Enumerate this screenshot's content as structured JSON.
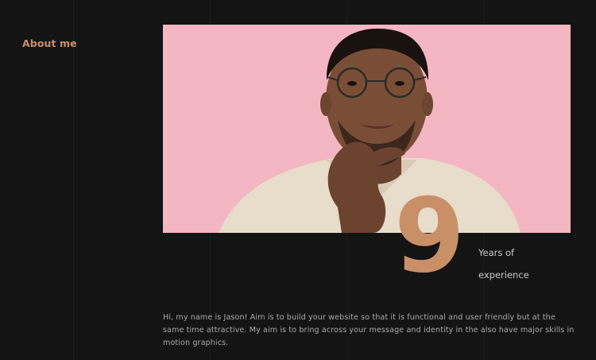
{
  "section": {
    "label": "About me"
  },
  "photo": {
    "subject": "portrait-photo",
    "background_color": "#f4b6c2"
  },
  "experience": {
    "number": "9",
    "line1": "Years of",
    "line2": "experience"
  },
  "bio": {
    "text": "Hi, my name is Jason! Aim is to build your website so that it is functional and user friendly but at the same time attractive. My aim is to bring across your message and identity in the also have major skills in motion graphics."
  },
  "colors": {
    "background": "#141414",
    "accent": "#c99068",
    "text": "#a8a8a8"
  }
}
